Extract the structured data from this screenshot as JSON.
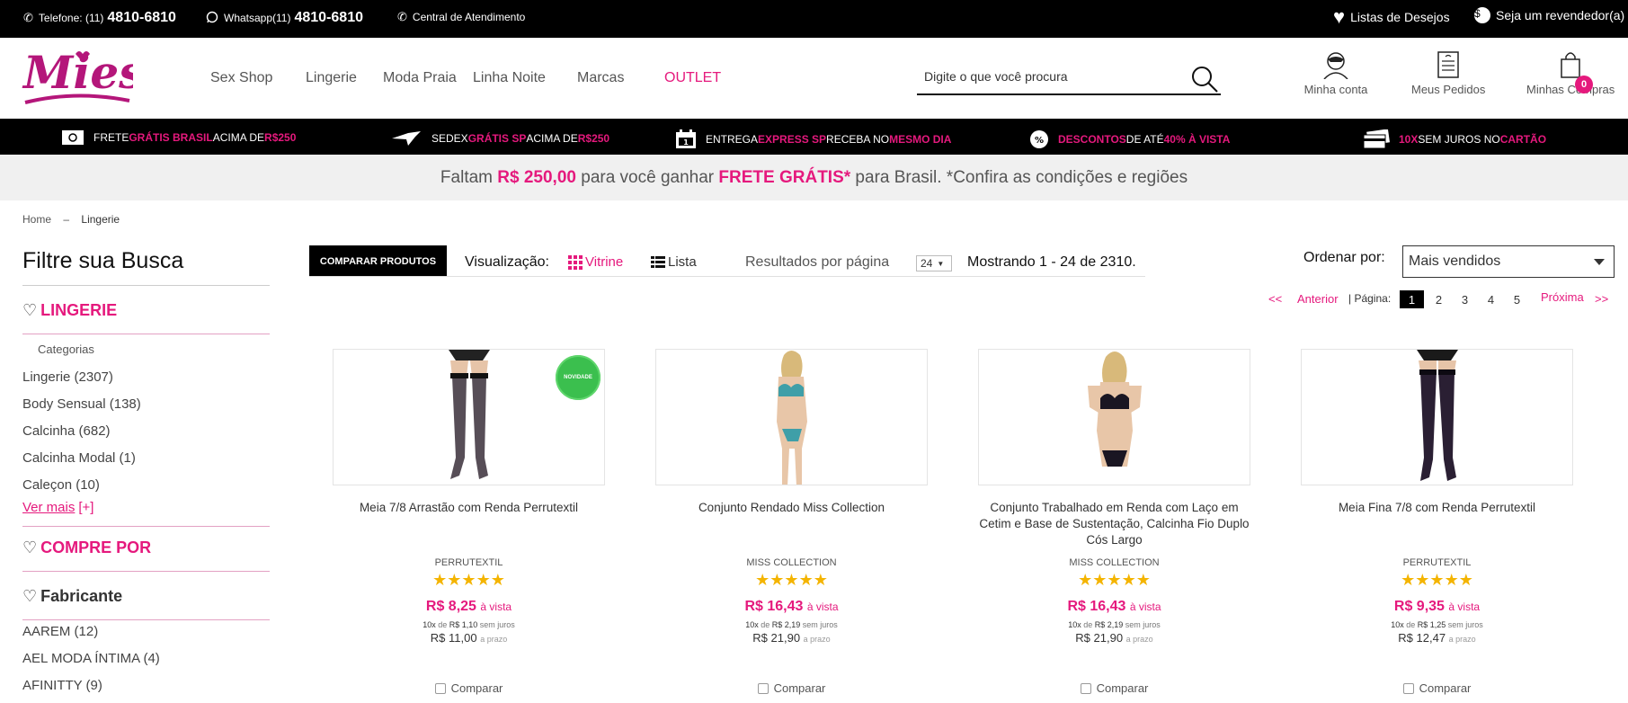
{
  "topbar": {
    "phone_label": "Telefone: (11)",
    "phone_number": "4810-6810",
    "whatsapp_label": "Whatsapp(11)",
    "whatsapp_number": "4810-6810",
    "central": "Central de Atendimento",
    "wishlist": "Listas de Desejos",
    "reseller": "Seja um revendedor(a)"
  },
  "header": {
    "logo_text": "Miess",
    "nav": [
      "Sex Shop",
      "Lingerie",
      "Moda Praia",
      "Linha Noite",
      "Marcas",
      "OUTLET"
    ],
    "search_placeholder": "Digite o que você procura",
    "account": "Minha conta",
    "orders": "Meus Pedidos",
    "cart": "Minhas Compras",
    "cart_count": "0"
  },
  "promos": [
    {
      "a": "Frete ",
      "b": "Grátis Brasil",
      "c": " acima de ",
      "d": "R$250"
    },
    {
      "a": "Sedex ",
      "b": "Grátis SP",
      "c": " acima de ",
      "d": "R$250"
    },
    {
      "a": "Entrega ",
      "b": "Express SP",
      "c": " receba no ",
      "d": "mesmo dia"
    },
    {
      "a": "",
      "b": "Descontos",
      "c": " de até ",
      "d": "40% à vista"
    },
    {
      "a": "",
      "b": "10X",
      "c": " sem juros no ",
      "d": "cartão"
    }
  ],
  "frete_banner": {
    "pre": "Faltam ",
    "value": "R$ 250,00",
    "mid": " para você ganhar ",
    "free": "FRETE GRÁTIS*",
    "post": " para Brasil. *Confira as condições e regiões"
  },
  "breadcrumb": {
    "home": "Home",
    "sep": "–",
    "current": "Lingerie"
  },
  "sidebar": {
    "title": "Filtre sua Busca",
    "section1": "LINGERIE",
    "categories_label": "Categorias",
    "categories": [
      "Lingerie (2307)",
      "Body Sensual (138)",
      "Calcinha (682)",
      "Calcinha Modal (1)",
      "Caleçon (10)"
    ],
    "ver_mais": "Ver mais",
    "ver_mais_plus": "[+]",
    "section2": "COMPRE POR",
    "section3": "Fabricante",
    "brands": [
      "AAREM (12)",
      "AEL MODA ÍNTIMA (4)",
      "AFINITTY (9)"
    ]
  },
  "toolbar": {
    "compare_btn": "Comparar produtos",
    "vis_label": "Visualização:",
    "vitrine": "Vitrine",
    "lista": "Lista",
    "res_label": "Resultados por página",
    "per_page": "24",
    "showing": "Mostrando 1 - 24 de 2310.",
    "sort_label": "Ordenar por:",
    "sort_value": "Mais vendidos"
  },
  "pagination": {
    "first": "<<",
    "prev": "Anterior",
    "page_label": "| Página:",
    "pages": [
      "1",
      "2",
      "3",
      "4",
      "5"
    ],
    "current": "1",
    "next": "Próxima",
    "last": ">>"
  },
  "products": [
    {
      "name": "Meia 7/8 Arrastão com Renda Perrutextil",
      "brand": "PERRUTEXTIL",
      "stars": "★★★★★",
      "rating": 5,
      "price": "R$ 8,25",
      "vista": "à vista",
      "inst_pre": "10x",
      "inst_de": "de",
      "inst_val": "R$ 1,10",
      "inst_post": "sem juros",
      "prazo": "R$ 11,00",
      "prazo_label": "a prazo",
      "compare": "Comparar",
      "badge": "NOVIDADE"
    },
    {
      "name": "Conjunto Rendado Miss Collection",
      "brand": "MISS COLLECTION",
      "stars": "★★★★★",
      "rating": 5,
      "price": "R$ 16,43",
      "vista": "à vista",
      "inst_pre": "10x",
      "inst_de": "de",
      "inst_val": "R$ 2,19",
      "inst_post": "sem juros",
      "prazo": "R$ 21,90",
      "prazo_label": "a prazo",
      "compare": "Comparar"
    },
    {
      "name": "Conjunto Trabalhado em Renda com Laço em Cetim e Base de Sustentação, Calcinha Fio Duplo Cós Largo",
      "brand": "MISS COLLECTION",
      "stars": "★★★★★",
      "rating": 5,
      "price": "R$ 16,43",
      "vista": "à vista",
      "inst_pre": "10x",
      "inst_de": "de",
      "inst_val": "R$ 2,19",
      "inst_post": "sem juros",
      "prazo": "R$ 21,90",
      "prazo_label": "a prazo",
      "compare": "Comparar"
    },
    {
      "name": "Meia Fina 7/8 com Renda Perrutextil",
      "brand": "PERRUTEXTIL",
      "stars": "★★★★★",
      "rating": 5,
      "price": "R$ 9,35",
      "vista": "à vista",
      "inst_pre": "10x",
      "inst_de": "de",
      "inst_val": "R$ 1,25",
      "inst_post": "sem juros",
      "prazo": "R$ 12,47",
      "prazo_label": "a prazo",
      "compare": "Comparar"
    }
  ],
  "colors": {
    "brand_pink": "#e5197d",
    "star": "#f4b400",
    "badge_green": "#3bbf4e"
  }
}
